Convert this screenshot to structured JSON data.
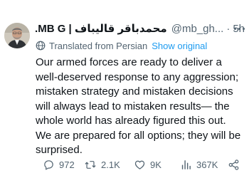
{
  "author": {
    "display_name": "محمدباقر قالیباف | MB G...",
    "handle": "@mb_gh...",
    "separator": "·",
    "time": "5h"
  },
  "translation": {
    "label": "Translated from Persian",
    "show_original": "Show original"
  },
  "tweet": {
    "text": "Our armed forces are ready to deliver a well-deserved response to any aggression; mistaken strategy and mistaken decisions will always lead to mistaken results— the whole world has already figured this out. We are prepared for all options; they will be surprised."
  },
  "metrics": {
    "replies": "972",
    "reposts": "2.1K",
    "likes": "9K",
    "views": "367K"
  },
  "icons": {
    "avatar": "avatar-photo",
    "more": "more-options-icon",
    "globe": "globe-icon",
    "reply": "reply-icon",
    "repost": "repost-icon",
    "like": "heart-icon",
    "views": "views-icon",
    "share": "share-icon"
  },
  "colors": {
    "text": "#0f1419",
    "secondary": "#536471",
    "link": "#1d9bf0"
  }
}
